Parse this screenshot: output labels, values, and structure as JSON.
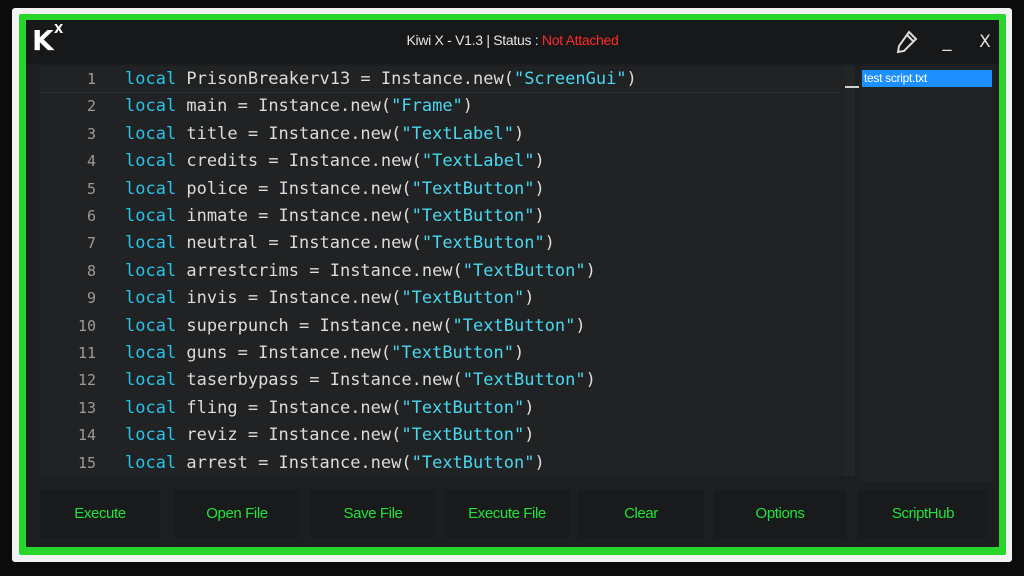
{
  "window": {
    "logo": "K",
    "logo_sup": "X",
    "title_prefix": "Kiwi X - V1.3 | Status : ",
    "status": "Not Attached",
    "status_color": "#ff2a2a",
    "accent_color": "#27d52b",
    "pin_icon": "pencil-pin-icon",
    "minimize_label": "_",
    "close_label": "X"
  },
  "editor": {
    "lines": [
      {
        "num": "1",
        "kw": "local",
        "name": " PrisonBreakerv13",
        "mid": " = Instance.new(",
        "str": "\"ScreenGui\"",
        "end": ")"
      },
      {
        "num": "2",
        "kw": "local",
        "name": " main",
        "mid": " = Instance.new(",
        "str": "\"Frame\"",
        "end": ")"
      },
      {
        "num": "3",
        "kw": "local",
        "name": " title",
        "mid": " = Instance.new(",
        "str": "\"TextLabel\"",
        "end": ")"
      },
      {
        "num": "4",
        "kw": "local",
        "name": " credits",
        "mid": " = Instance.new(",
        "str": "\"TextLabel\"",
        "end": ")"
      },
      {
        "num": "5",
        "kw": "local",
        "name": " police",
        "mid": " = Instance.new(",
        "str": "\"TextButton\"",
        "end": ")"
      },
      {
        "num": "6",
        "kw": "local",
        "name": " inmate",
        "mid": " = Instance.new(",
        "str": "\"TextButton\"",
        "end": ")"
      },
      {
        "num": "7",
        "kw": "local",
        "name": " neutral",
        "mid": " = Instance.new(",
        "str": "\"TextButton\"",
        "end": ")"
      },
      {
        "num": "8",
        "kw": "local",
        "name": " arrestcrims",
        "mid": " = Instance.new(",
        "str": "\"TextButton\"",
        "end": ")"
      },
      {
        "num": "9",
        "kw": "local",
        "name": " invis",
        "mid": " = Instance.new(",
        "str": "\"TextButton\"",
        "end": ")"
      },
      {
        "num": "10",
        "kw": "local",
        "name": " superpunch",
        "mid": " = Instance.new(",
        "str": "\"TextButton\"",
        "end": ")"
      },
      {
        "num": "11",
        "kw": "local",
        "name": " guns",
        "mid": " = Instance.new(",
        "str": "\"TextButton\"",
        "end": ")"
      },
      {
        "num": "12",
        "kw": "local",
        "name": " taserbypass",
        "mid": " = Instance.new(",
        "str": "\"TextButton\"",
        "end": ")"
      },
      {
        "num": "13",
        "kw": "local",
        "name": " fling",
        "mid": " = Instance.new(",
        "str": "\"TextButton\"",
        "end": ")"
      },
      {
        "num": "14",
        "kw": "local",
        "name": " reviz",
        "mid": " = Instance.new(",
        "str": "\"TextButton\"",
        "end": ")"
      },
      {
        "num": "15",
        "kw": "local",
        "name": " arrest",
        "mid": " = Instance.new(",
        "str": "\"TextButton\"",
        "end": ")"
      }
    ]
  },
  "script_list": {
    "items": [
      "test script.txt"
    ]
  },
  "buttons": {
    "execute": "Execute",
    "open_file": "Open File",
    "save_file": "Save File",
    "execute_file": "Execute File",
    "clear": "Clear",
    "options": "Options",
    "script_hub": "ScriptHub"
  }
}
